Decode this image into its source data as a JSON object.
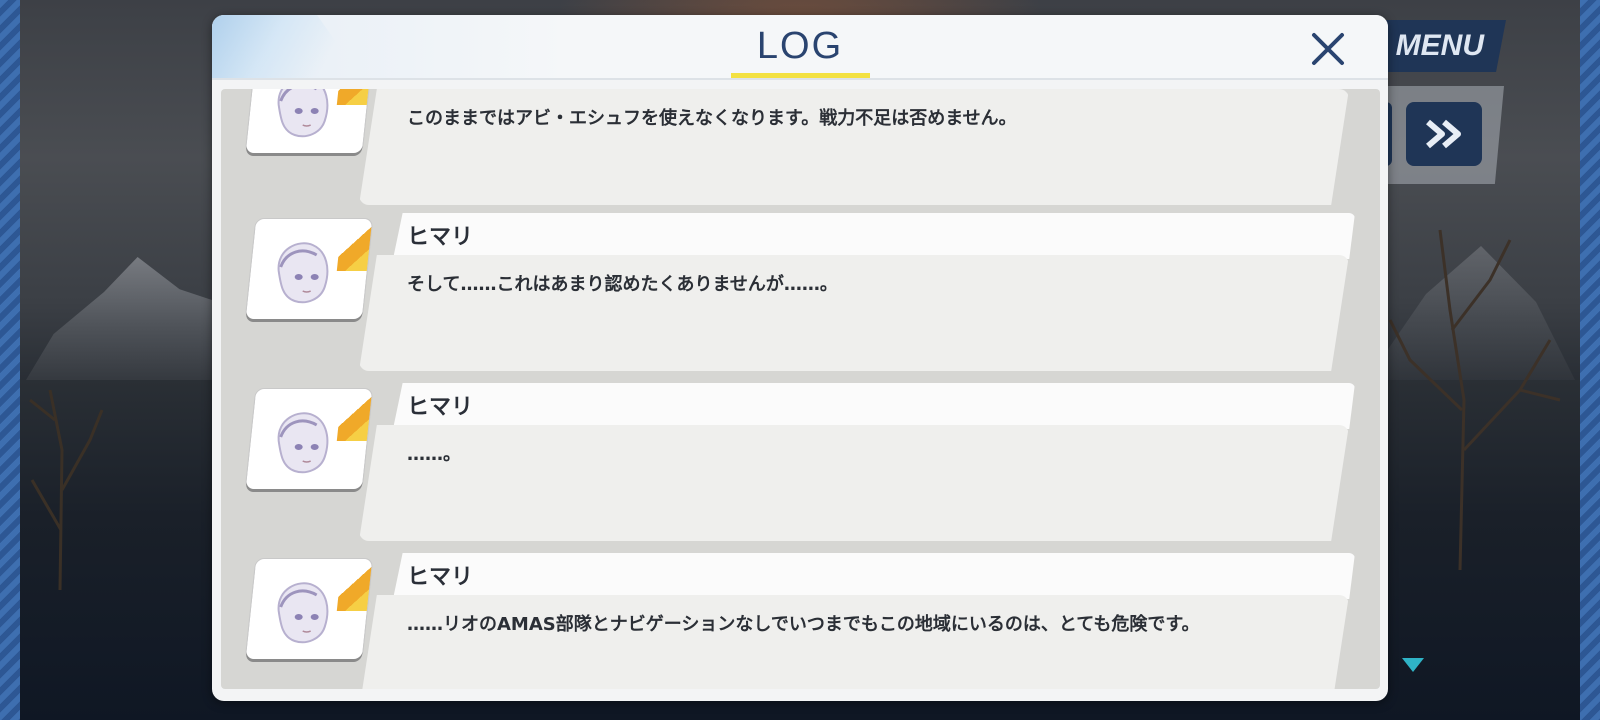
{
  "hud": {
    "menu_label": "MENU"
  },
  "log": {
    "title": "LOG",
    "entries": [
      {
        "speaker": "",
        "text": "このままではアビ・エシュフを使えなくなります。戦力不足は否めません。"
      },
      {
        "speaker": "ヒマリ",
        "text": "そして……これはあまり認めたくありませんが……。"
      },
      {
        "speaker": "ヒマリ",
        "text": "……。"
      },
      {
        "speaker": "ヒマリ",
        "text": "……リオのAMAS部隊とナビゲーションなしでいつまでもこの地域にいるのは、とても危険です。"
      }
    ]
  },
  "colors": {
    "accent_underline": "#f3e142",
    "header_text": "#2a4470",
    "hud_button": "#1f3556",
    "avatar_stripe": "#f0a929",
    "indicator": "#2fb3c6"
  },
  "icons": [
    "close-icon",
    "fast-forward-icon",
    "character-portrait-icon",
    "scroll-indicator-icon"
  ]
}
